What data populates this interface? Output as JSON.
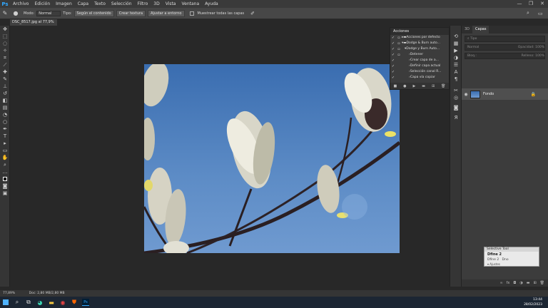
{
  "app": {
    "logo": "Ps",
    "menu": [
      "Archivo",
      "Edición",
      "Imagen",
      "Capa",
      "Texto",
      "Selección",
      "Filtro",
      "3D",
      "Vista",
      "Ventana",
      "Ayuda"
    ],
    "window_controls": [
      "—",
      "❐",
      "✕"
    ]
  },
  "options_bar": {
    "mode_label": "Modo:",
    "mode_value": "Normal",
    "tip_label": "Tipo:",
    "btn_content": "Según el contenido",
    "btn_texture": "Crear textura",
    "btn_env": "Ajustar a entorno",
    "sample_all": "Muestrear todas las capas"
  },
  "document": {
    "tab_title": "DSC_8517.jpg al 77,9% (RGB/8)",
    "close": "×"
  },
  "status": {
    "zoom": "77,89%",
    "doc": "Doc: 2,80 MB/2,80 MB"
  },
  "actions": {
    "title": "Acciones",
    "rows": [
      {
        "label": "Acciones por defecto",
        "indent": 0
      },
      {
        "label": "Dodge & Burn auto...",
        "indent": 0
      },
      {
        "label": "Dodge y Burn Auto...",
        "indent": 1
      },
      {
        "label": "Detener",
        "indent": 2
      },
      {
        "label": "Crear capa de a...",
        "indent": 2
      },
      {
        "label": "Definir capa actual",
        "indent": 2
      },
      {
        "label": "Selección canal R...",
        "indent": 2
      },
      {
        "label": "Capa vía copiar",
        "indent": 2
      }
    ]
  },
  "layers": {
    "tabs": [
      "3D",
      "Capas"
    ],
    "active_tab": "Capas",
    "search_placeholder": "Tipo",
    "blend": "Normal",
    "opacity_label": "Opacidad:",
    "opacity": "100%",
    "lock_label": "Bloq.:",
    "fill_label": "Relleno:",
    "fill": "100%",
    "layer_name": "Fondo"
  },
  "selective_tool": {
    "title": "Selective Tool",
    "name": "Dfine 2",
    "sub1": "Dfine 2",
    "sub1b": "Dno",
    "ajustes": "Ajustes"
  },
  "taskbar": {
    "time": "13:44",
    "date": "28/02/2023"
  }
}
